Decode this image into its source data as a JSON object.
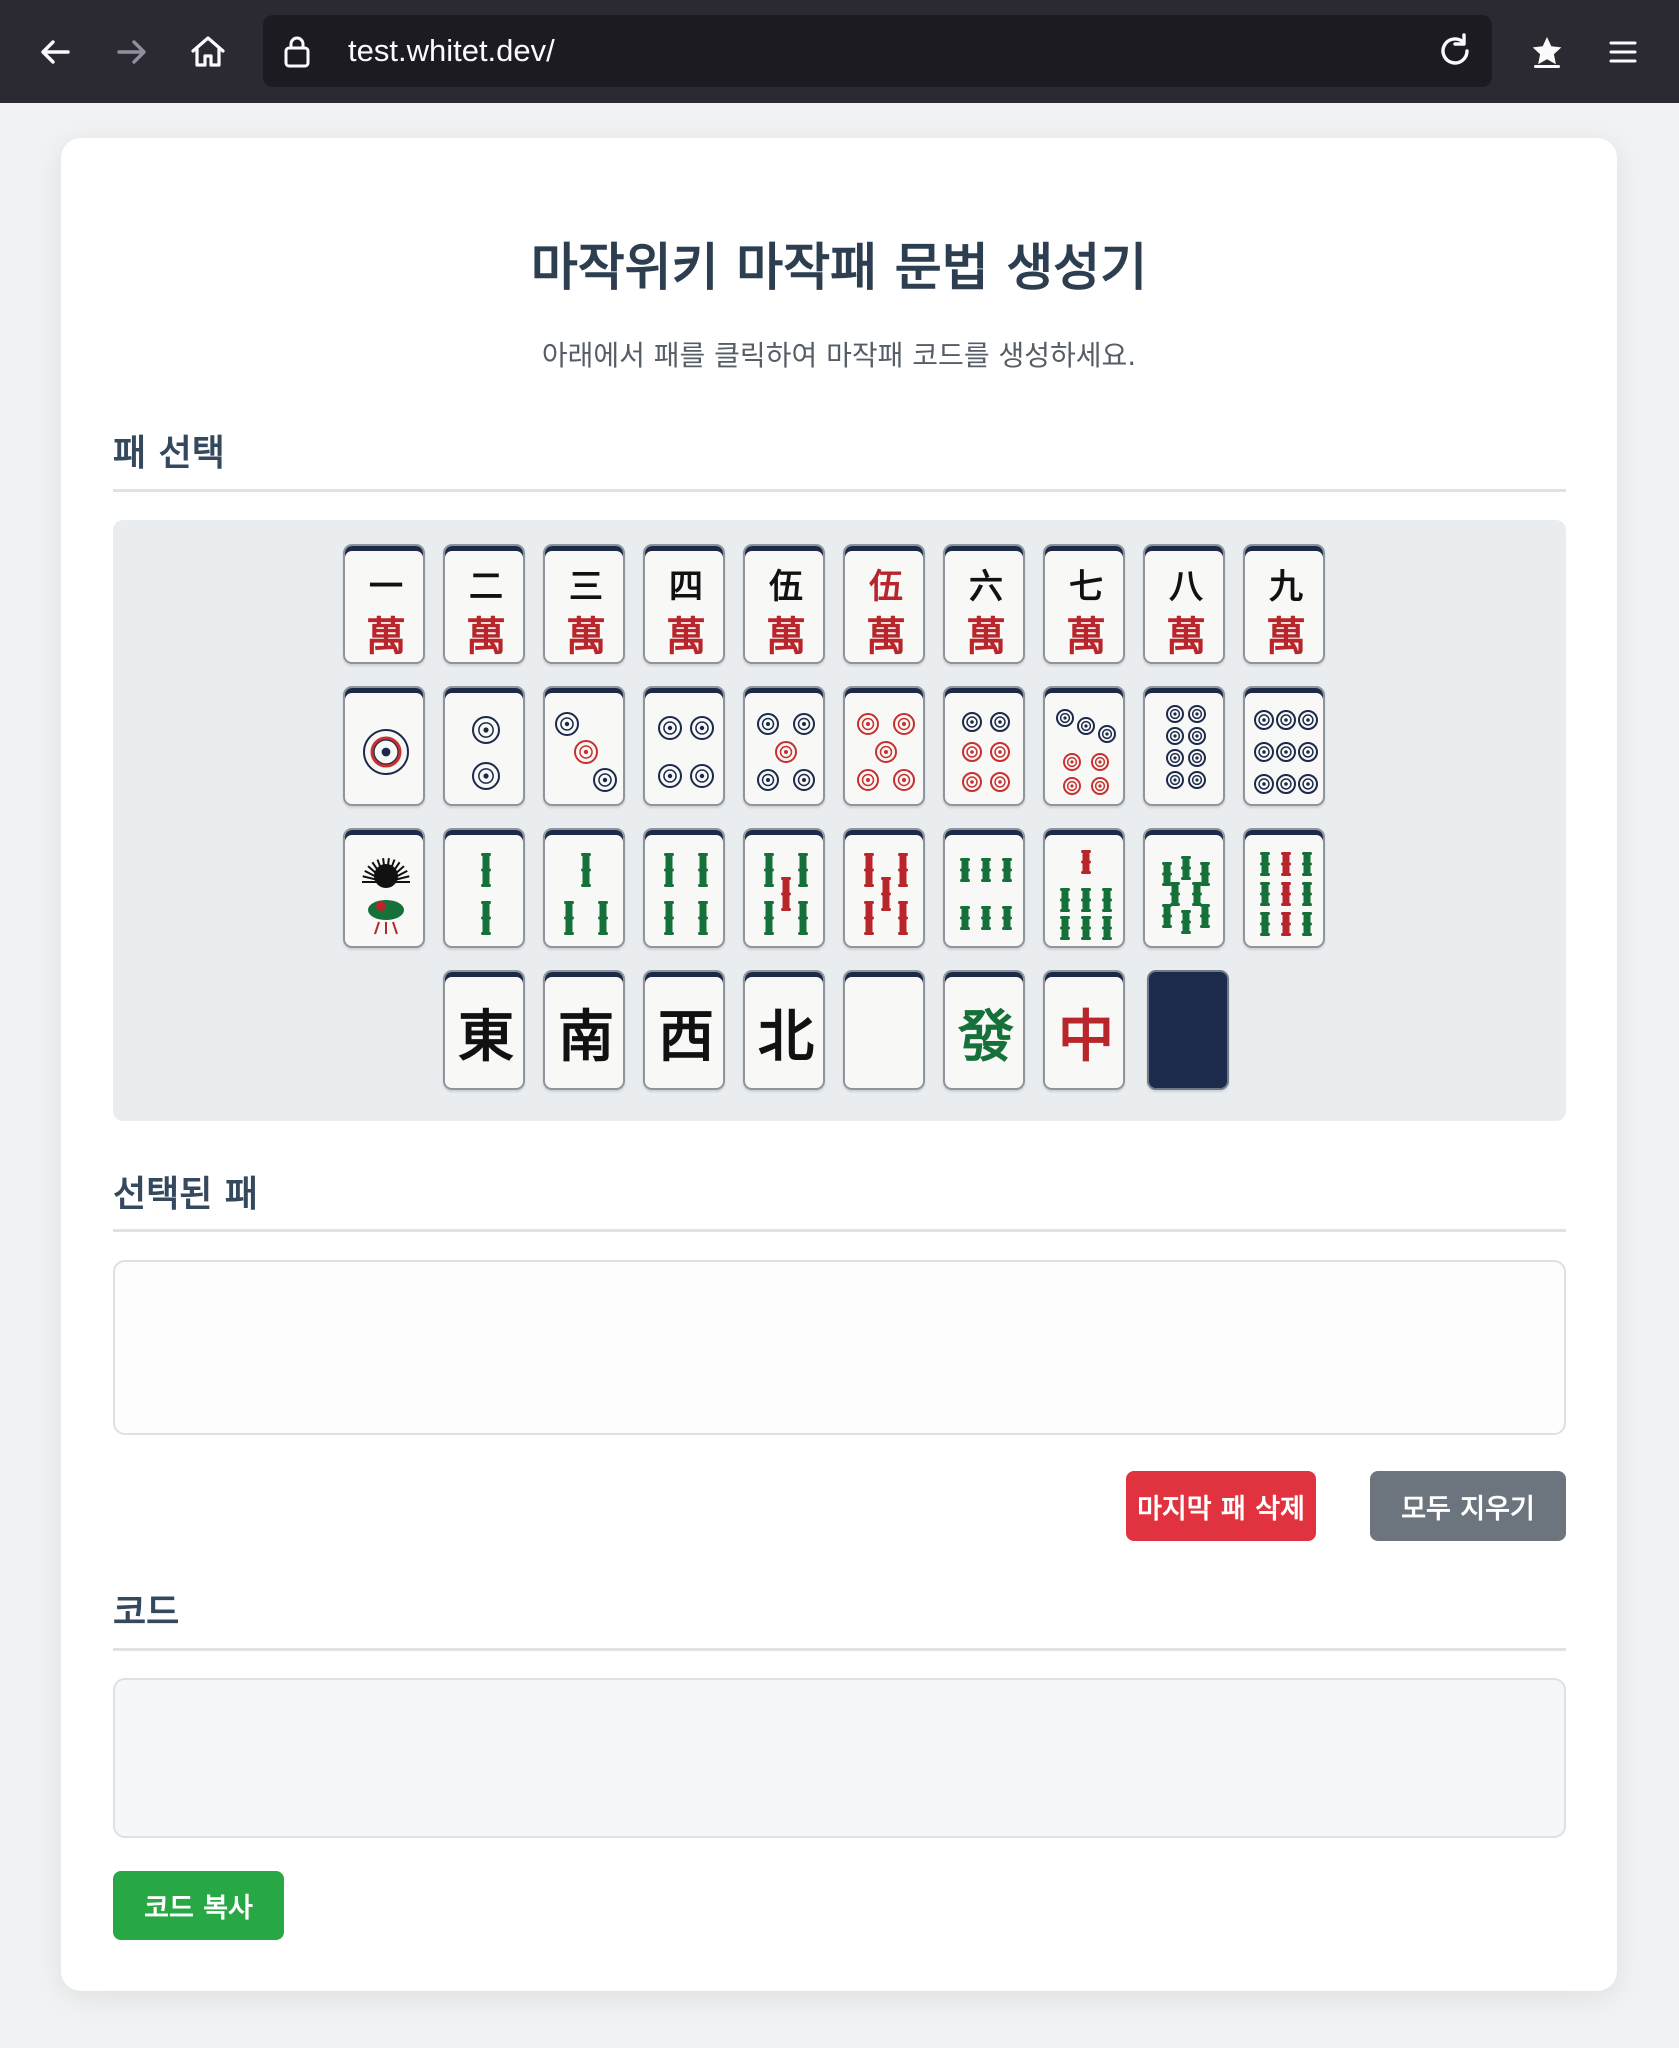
{
  "browser": {
    "url": "test.whitet.dev/"
  },
  "page": {
    "title": "마작위키 마작패 문법 생성기",
    "subtitle": "아래에서 패를 클릭하여 마작패 코드를 생성하세요.",
    "sections": {
      "tile_select": "패 선택",
      "selected_tiles": "선택된 패",
      "code": "코드"
    },
    "buttons": {
      "delete_last": "마지막 패 삭제",
      "clear_all": "모두 지우기",
      "copy_code": "코드 복사"
    },
    "selected_tiles_value": "",
    "code_value": ""
  },
  "tiles": {
    "man": [
      {
        "numeral": "一",
        "suit": "萬"
      },
      {
        "numeral": "二",
        "suit": "萬"
      },
      {
        "numeral": "三",
        "suit": "萬"
      },
      {
        "numeral": "四",
        "suit": "萬"
      },
      {
        "numeral": "伍",
        "suit": "萬"
      },
      {
        "numeral": "伍",
        "suit": "萬",
        "red": true
      },
      {
        "numeral": "六",
        "suit": "萬"
      },
      {
        "numeral": "七",
        "suit": "萬"
      },
      {
        "numeral": "八",
        "suit": "萬"
      },
      {
        "numeral": "九",
        "suit": "萬"
      }
    ],
    "pin": [
      1,
      2,
      3,
      4,
      5,
      "5-red",
      6,
      7,
      8,
      9
    ],
    "sou": [
      1,
      2,
      3,
      4,
      5,
      "5-red",
      6,
      7,
      8,
      9
    ],
    "honors": [
      "東",
      "南",
      "西",
      "北",
      "",
      "發",
      "中",
      "back"
    ]
  },
  "colors": {
    "numeral": "#111111",
    "manzu_red": "#b8262c",
    "pin_navy": "#1b2a4a",
    "pin_red": "#c8302f",
    "sou_green": "#16703a",
    "sou_red": "#b8262c",
    "tile_back": "#1c2a4c"
  }
}
